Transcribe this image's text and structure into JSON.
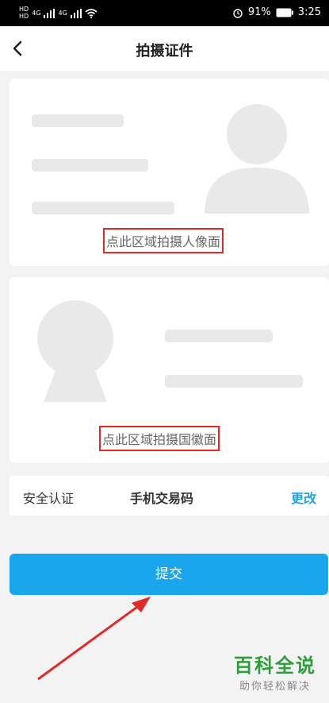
{
  "status_bar": {
    "network_left": "HD",
    "network_left_2": "HD",
    "sig_label_1": "4G",
    "sig_label_2": "4G",
    "battery": "91%",
    "time": "3:25"
  },
  "header": {
    "title": "拍摄证件"
  },
  "portrait_card": {
    "hint": "点此区域拍摄人像面"
  },
  "emblem_card": {
    "hint": "点此区域拍摄国徽面"
  },
  "security": {
    "label": "安全认证",
    "value": "手机交易码",
    "change_label": "更改"
  },
  "submit": {
    "label": "提交"
  },
  "watermark": {
    "main": "百科全说",
    "sub": "助你轻松解决"
  },
  "colors": {
    "accent": "#1aa6ec",
    "highlight_frame": "#e02a2a",
    "arrow": "#e02a2a"
  }
}
